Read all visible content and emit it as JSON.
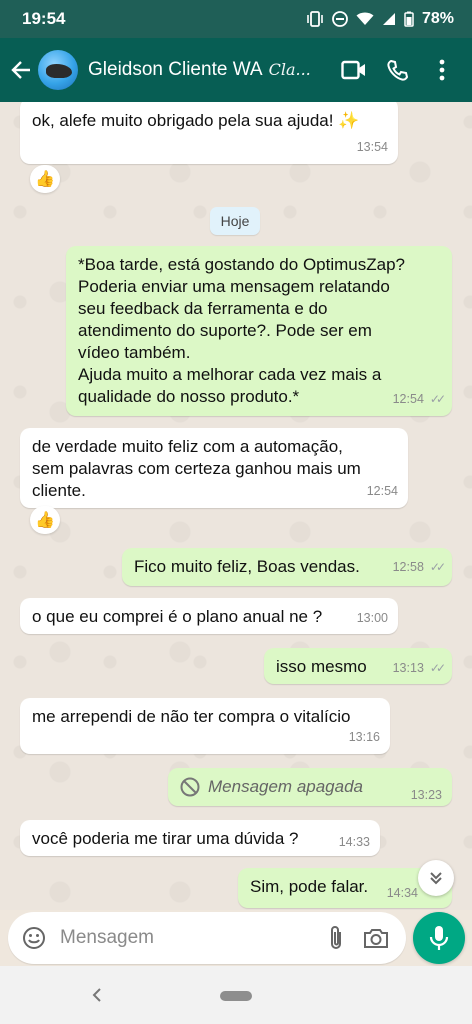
{
  "status_bar": {
    "time": "19:54",
    "battery": "78%"
  },
  "header": {
    "contact_name": "Gleidson Cliente WA",
    "contact_suffix": "Cla..."
  },
  "chat": {
    "day_separator": "Hoje",
    "messages": [
      {
        "type": "incoming",
        "text": "ok, alefe muito obrigado pela sua ajuda! ✨",
        "time": "13:54",
        "reaction": "👍"
      },
      {
        "type": "outgoing",
        "text": "*Boa tarde, está gostando do OptimusZap?\nPoderia enviar uma mensagem relatando\nseu feedback da ferramenta e do\natendimento do suporte?. Pode ser em\nvídeo também.\nAjuda muito a melhorar cada vez mais a\nqualidade do nosso produto.*",
        "time": "12:54"
      },
      {
        "type": "incoming",
        "text": "de verdade muito feliz com a automação,\nsem palavras com certeza ganhou mais um\ncliente.",
        "time": "12:54",
        "reaction": "👍"
      },
      {
        "type": "outgoing",
        "text": "Fico muito feliz, Boas vendas.",
        "time": "12:58"
      },
      {
        "type": "incoming",
        "text": "o que eu comprei é o plano anual ne ?",
        "time": "13:00"
      },
      {
        "type": "outgoing",
        "text": "isso mesmo",
        "time": "13:13"
      },
      {
        "type": "incoming",
        "text": "me arrependi de não ter compra o vitalício",
        "time": "13:16"
      },
      {
        "type": "outgoing-deleted",
        "text": "Mensagem apagada",
        "time": "13:23"
      },
      {
        "type": "incoming",
        "text": "você poderia me tirar uma dúvida ?",
        "time": "14:33"
      },
      {
        "type": "outgoing",
        "text": "Sim, pode falar.",
        "time": "14:34"
      }
    ]
  },
  "composer": {
    "placeholder": "Mensagem"
  },
  "icons": {
    "back": "arrow-left-icon",
    "video": "video-camera-icon",
    "call": "phone-icon",
    "menu": "more-vertical-icon",
    "emoji": "emoji-icon",
    "attach": "paperclip-icon",
    "camera": "camera-icon",
    "mic": "microphone-icon",
    "scroll": "double-chevron-down-icon",
    "deleted": "block-icon"
  },
  "colors": {
    "header": "#075e54",
    "outgoing_bubble": "#dcf8c6",
    "incoming_bubble": "#ffffff",
    "accent": "#00a884"
  }
}
